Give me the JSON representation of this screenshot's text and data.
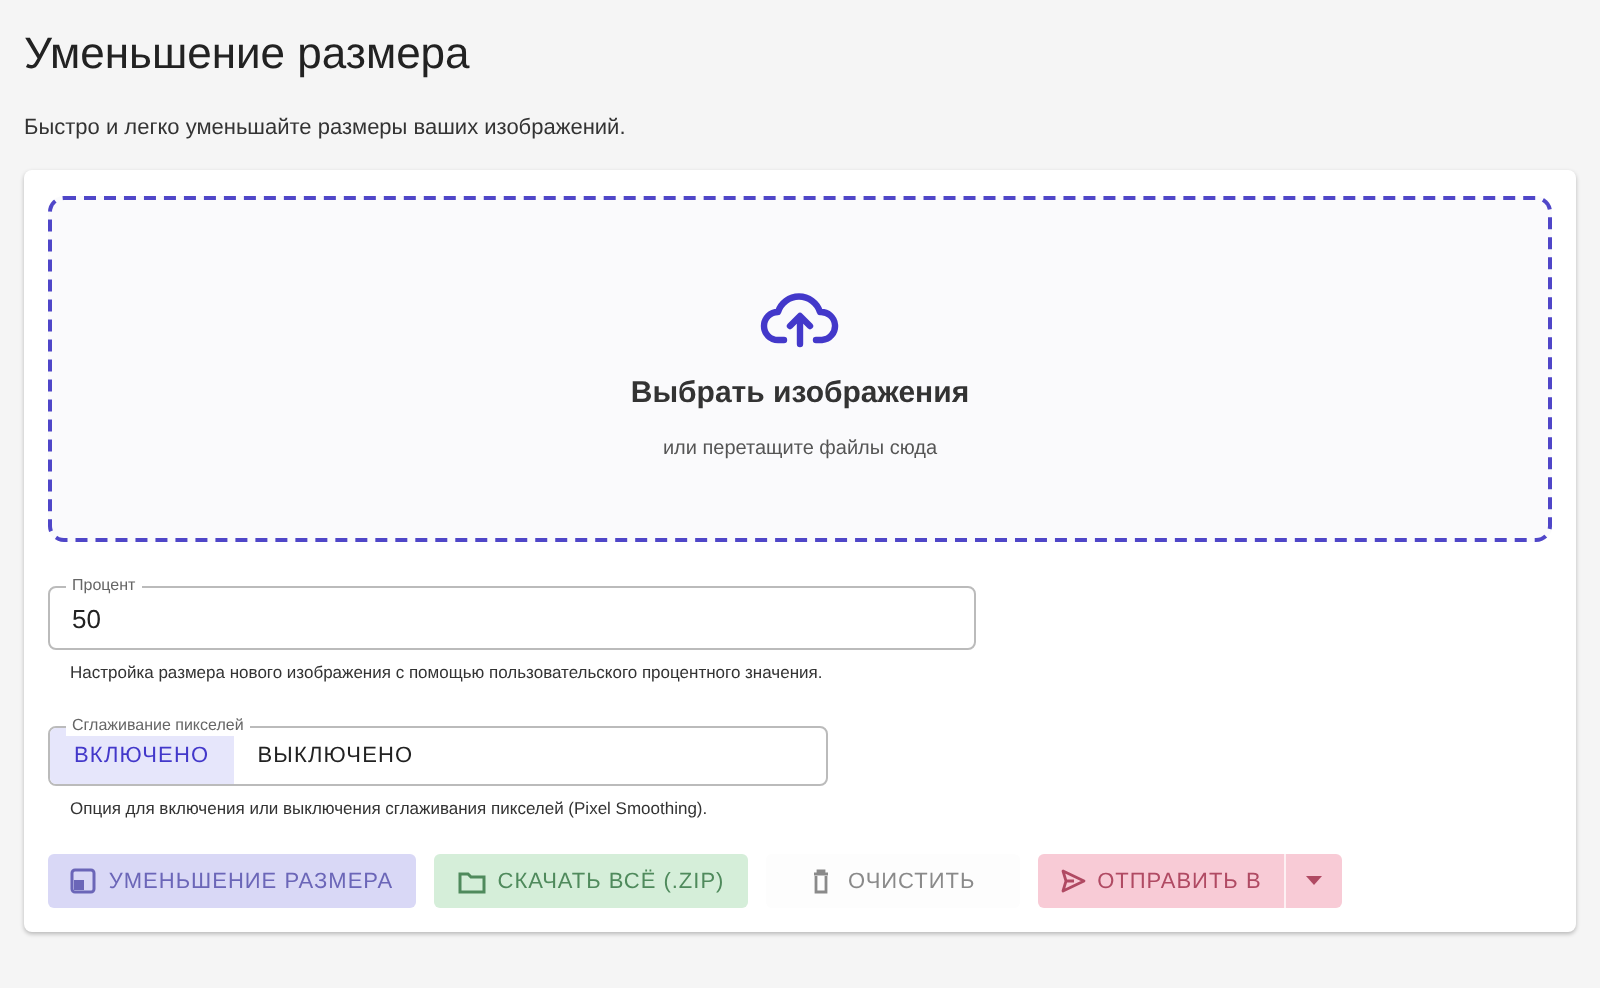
{
  "title": "Уменьшение размера",
  "subtitle": "Быстро и легко уменьшайте размеры ваших изображений.",
  "dropzone": {
    "title": "Выбрать изображения",
    "hint": "или перетащите файлы сюда"
  },
  "percent_field": {
    "label": "Процент",
    "value": "50",
    "help": "Настройка размера нового изображения с помощью пользовательского процентного значения."
  },
  "smoothing": {
    "label": "Сглаживание пикселей",
    "options": [
      {
        "label": "ВКЛЮЧЕНО",
        "selected": true
      },
      {
        "label": "ВЫКЛЮЧЕНО",
        "selected": false
      }
    ],
    "help": "Опция для включения или выключения сглаживания пикселей (Pixel Smoothing)."
  },
  "buttons": [
    {
      "label": "УМЕНЬШЕНИЕ РАЗМЕРА",
      "kind": "primary",
      "disabled": true,
      "has_menu": false
    },
    {
      "label": "СКАЧАТЬ ВСЁ (.ZIP)",
      "kind": "success",
      "disabled": true,
      "has_menu": false
    },
    {
      "label": "ОЧИСТИТЬ",
      "kind": "neutral",
      "disabled": true,
      "has_menu": false
    },
    {
      "label": "ОТПРАВИТЬ В",
      "kind": "danger",
      "disabled": true,
      "has_menu": true
    }
  ]
}
